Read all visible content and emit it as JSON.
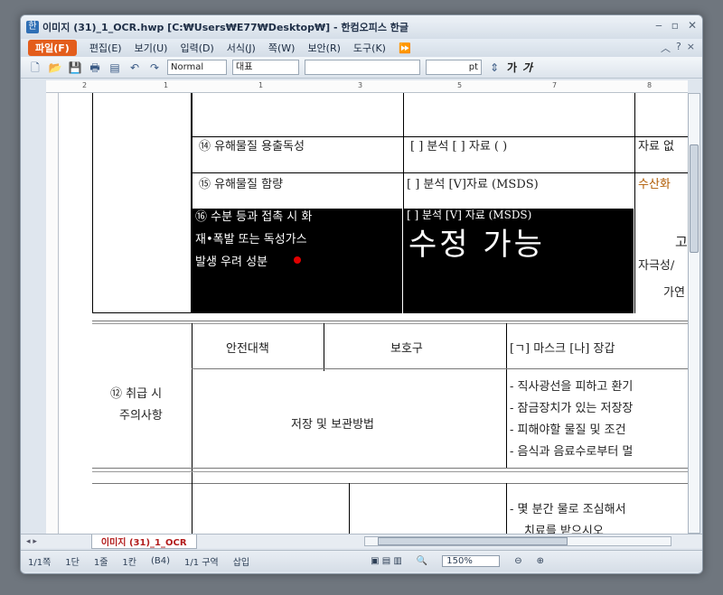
{
  "window": {
    "title": "이미지 (31)_1_OCR.hwp [C:₩Users₩E77₩Desktop₩] - 한컴오피스 한글",
    "app_icon": "한"
  },
  "menu": {
    "file": "파일(F)",
    "items": [
      "편집(E)",
      "보기(U)",
      "입력(D)",
      "서식(J)",
      "쪽(W)",
      "보안(R)",
      "도구(K)"
    ],
    "help": "?"
  },
  "toolbar": {
    "style": "Normal",
    "font_group": "대표",
    "font_name": "",
    "size_unit": "pt",
    "bold_label": "가",
    "italic_label": "가"
  },
  "document": {
    "row14": {
      "label": "⑭ 유해물질 용출독성",
      "choice": "[ ] 분석  [ ] 자료 ( )",
      "right": "자료 없"
    },
    "row15": {
      "label": "⑮ 유해물질 함량",
      "choice": "[ ] 분석 [V]자료 (MSDS)",
      "right": "수산화"
    },
    "row16": {
      "label_lines": [
        "⑯ 수분 등과 접촉 시 화",
        "재•폭발 또는 독성가스",
        "발생 우려 성분"
      ],
      "choice": "[ ] 분석 [V] 자료 (MSDS)",
      "watermark": "수정 가능",
      "right_lines": [
        "고",
        "자극성/",
        "가연"
      ]
    },
    "handling": {
      "section_label_lines": [
        "⑫ 취급 시",
        "주의사항"
      ],
      "header_col1": "안전대책",
      "header_col2": "보호구",
      "header_col3": "[ㄱ] 마스크  [나] 장갑",
      "storage_label": "저장 및 보관방법",
      "storage_items": [
        "- 직사광선을 피하고 환기",
        "- 잠금장치가 있는 저장장",
        "- 피해야할 물질 및 조건",
        "- 음식과 음료수로부터 멀"
      ],
      "next_lines": [
        "- 몇 분간 물로 조심해서",
        "치료를 받으시오"
      ]
    }
  },
  "tabs": {
    "doc_tab": "이미지 (31)_1_OCR"
  },
  "status": {
    "page": "1/1쪽",
    "column": "1단",
    "line": "1줄",
    "char": "1칸",
    "paper": "(B4)",
    "section": "1/1 구역",
    "mode": "삽입",
    "zoom": "150%"
  }
}
